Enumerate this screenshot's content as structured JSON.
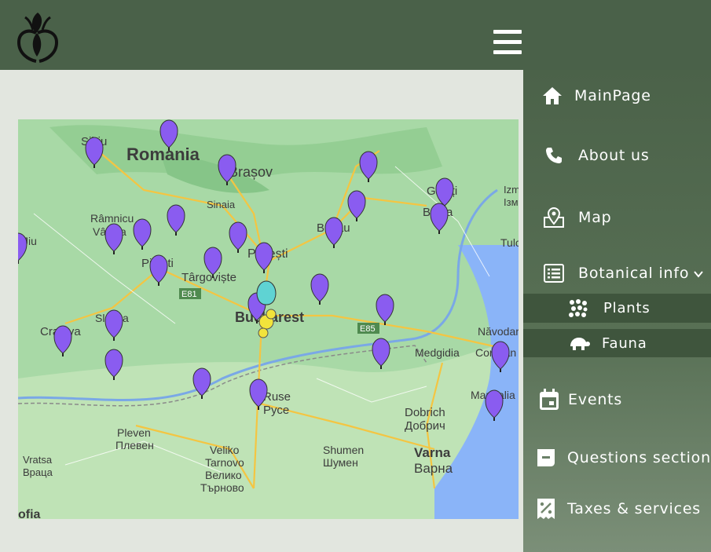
{
  "header": {
    "logo": "flower-logo",
    "menu_icon": "hamburger-icon"
  },
  "nav": {
    "items": [
      {
        "label": "MainPage",
        "icon": "home-icon"
      },
      {
        "label": "About us",
        "icon": "phone-icon"
      },
      {
        "label": "Map",
        "icon": "map-pin-icon"
      },
      {
        "label": "Botanical info",
        "icon": "list-icon",
        "expanded": true,
        "children": [
          {
            "label": "Plants",
            "icon": "plants-icon"
          },
          {
            "label": "Fauna",
            "icon": "turtle-icon"
          }
        ]
      },
      {
        "label": "Events",
        "icon": "calendar-icon"
      },
      {
        "label": "Questions section",
        "icon": "chat-icon"
      },
      {
        "label": "Taxes & services",
        "icon": "receipt-percent-icon"
      }
    ]
  },
  "map": {
    "labels": {
      "romania": "Romania",
      "brasov": "Brașov",
      "sibiu": "Sibiu",
      "sinaia": "Sinaia",
      "buzau": "Buzău",
      "galati": "Galați",
      "braila": "Brăila",
      "izmail": "Izm",
      "izmail2": "Ізм",
      "tulcea": "Tulc",
      "ramnicu": "Râmnicu",
      "valcea": "Vâlcea",
      "tjiu": "Jiu",
      "pitesti": "Pitești",
      "targoviste": "Târgoviște",
      "ploiesti": "Ploiești",
      "bucharest": "Bucharest",
      "slatina": "Slatina",
      "craiova": "Craiova",
      "e81": "E81",
      "e85": "E85",
      "medgidia": "Medgidia",
      "constanta": "Constan",
      "navodari": "Năvodari",
      "mangalia": "Mangalia",
      "ruse": "Ruse",
      "ruse_cyr": "Русе",
      "pleven": "Pleven",
      "pleven_cyr": "Плевен",
      "dobrich": "Dobrich",
      "dobrich_cyr": "Добрич",
      "vratsa": "Vratsa",
      "vratsa_cyr": "Враца",
      "veliko": "Veliko",
      "tarnovo": "Tarnovo",
      "veliko_cyr": "Велико",
      "tarnovo_cyr": "Търново",
      "shumen": "Shumen",
      "shumen_cyr": "Шумен",
      "varna": "Varna",
      "varna_cyr": "Варна",
      "sofia": "ofia"
    }
  }
}
